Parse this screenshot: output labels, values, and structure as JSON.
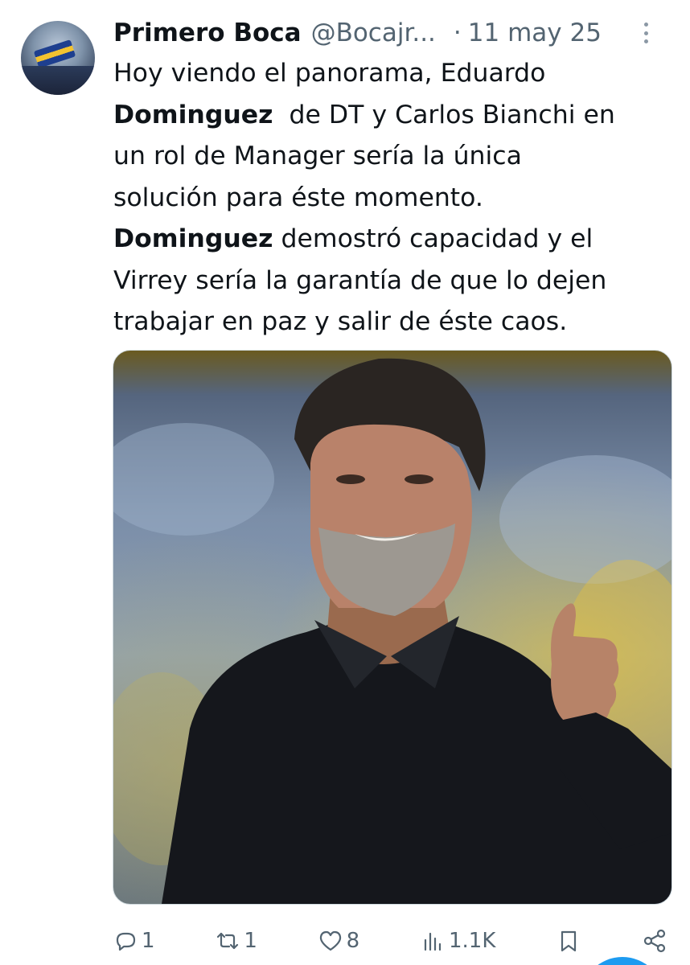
{
  "tweet": {
    "author_name": "Primero Boca",
    "handle": "@Bocajr...",
    "separator": "·",
    "date": "11 may 25",
    "text_lines": [
      [
        {
          "t": "Hoy viendo el panorama, Eduardo",
          "b": false
        }
      ],
      [
        {
          "t": "Dominguez",
          "b": true
        },
        {
          "t": "  de DT y Carlos Bianchi en",
          "b": false
        }
      ],
      [
        {
          "t": "un rol de Manager sería la única",
          "b": false
        }
      ],
      [
        {
          "t": "solución para éste momento.",
          "b": false
        }
      ],
      [
        {
          "t": "Dominguez",
          "b": true
        },
        {
          "t": " demostró capacidad y el",
          "b": false
        }
      ],
      [
        {
          "t": "Virrey sería la garantía de que lo dejen",
          "b": false
        }
      ],
      [
        {
          "t": "trabajar en paz y salir de éste caos.",
          "b": false
        }
      ]
    ]
  },
  "actions": {
    "reply": {
      "icon": "reply-icon",
      "count": "1"
    },
    "repost": {
      "icon": "repost-icon",
      "count": "1"
    },
    "like": {
      "icon": "heart-icon",
      "count": "8"
    },
    "views": {
      "icon": "views-chart-icon",
      "count": "1.1K"
    },
    "bookmark": {
      "icon": "bookmark-icon"
    },
    "share": {
      "icon": "share-icon"
    }
  },
  "colors": {
    "text_primary": "#0f1419",
    "text_secondary": "#536471",
    "accent": "#1d9bf0"
  }
}
